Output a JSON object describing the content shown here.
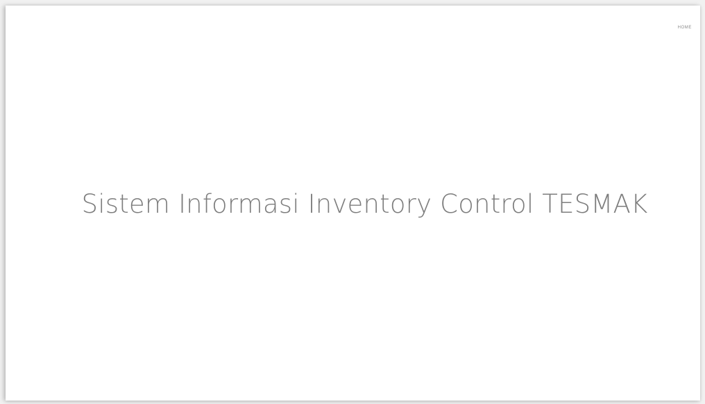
{
  "nav": {
    "home_label": "HOME"
  },
  "hero": {
    "title": "Sistem Informasi Inventory Control TESMAK"
  },
  "colors": {
    "background": "#ffffff",
    "title_text": "#7d7d7d",
    "nav_text": "#8a8a8a"
  }
}
